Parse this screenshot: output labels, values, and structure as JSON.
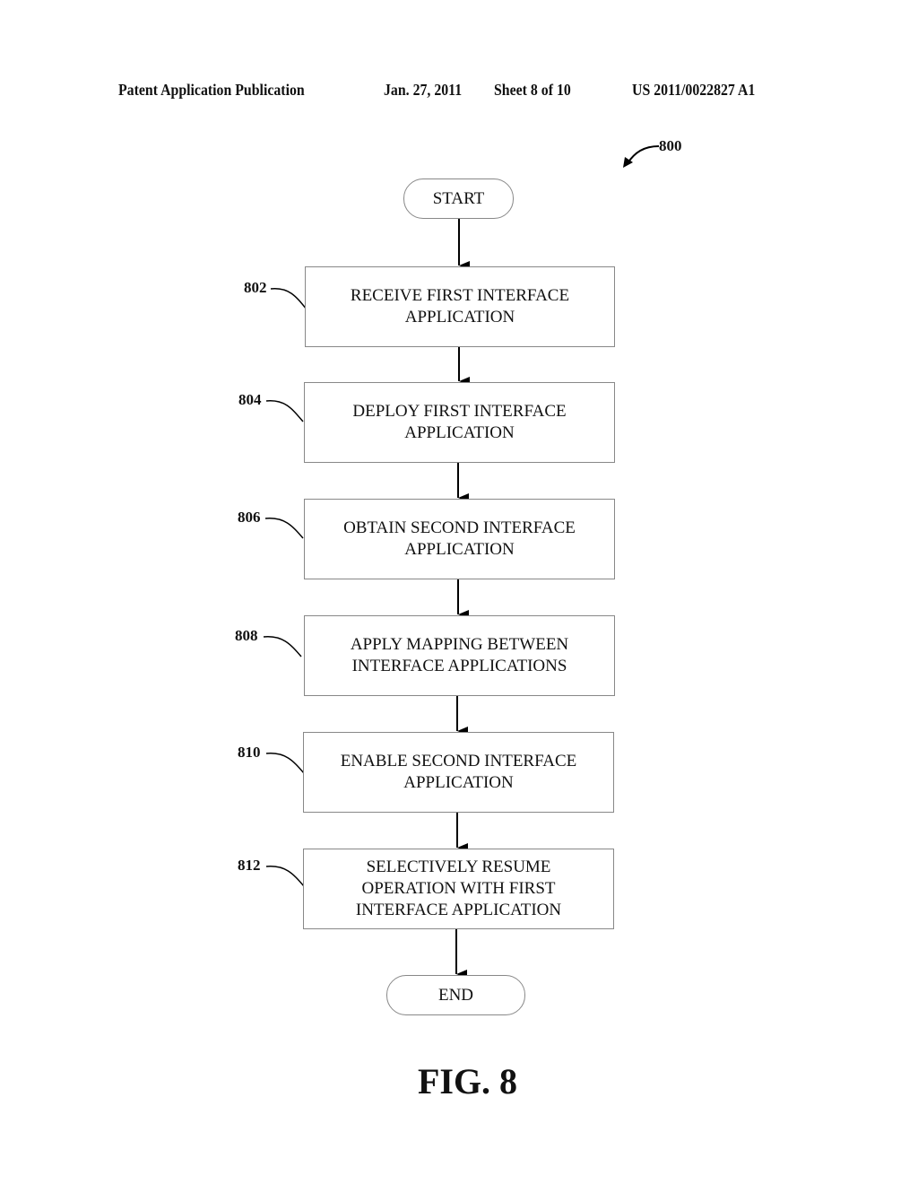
{
  "header": {
    "publication": "Patent Application Publication",
    "date": "Jan. 27, 2011",
    "sheet": "Sheet 8 of 10",
    "number": "US 2011/0022827 A1"
  },
  "figure": {
    "ref": "800",
    "caption": "FIG. 8",
    "start": "START",
    "end": "END",
    "steps": [
      {
        "ref": "802",
        "text": "RECEIVE FIRST INTERFACE APPLICATION"
      },
      {
        "ref": "804",
        "text": "DEPLOY FIRST INTERFACE APPLICATION"
      },
      {
        "ref": "806",
        "text": "OBTAIN SECOND INTERFACE APPLICATION"
      },
      {
        "ref": "808",
        "text": "APPLY MAPPING BETWEEN INTERFACE APPLICATIONS"
      },
      {
        "ref": "810",
        "text": "ENABLE SECOND INTERFACE APPLICATION"
      },
      {
        "ref": "812",
        "text": "SELECTIVELY RESUME OPERATION WITH FIRST INTERFACE APPLICATION"
      }
    ]
  }
}
